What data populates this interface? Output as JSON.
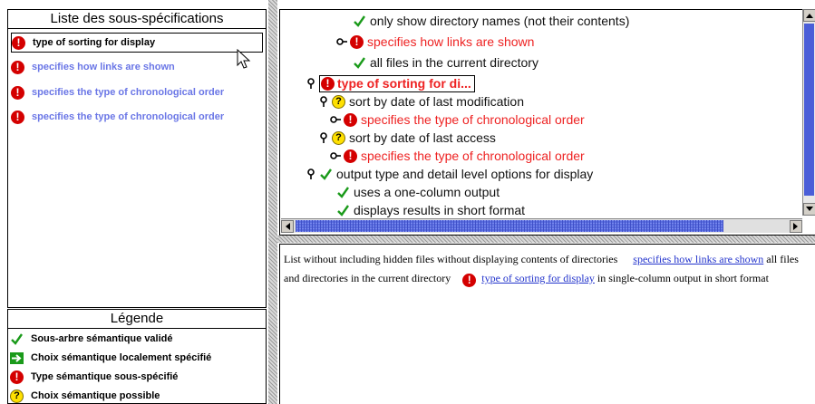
{
  "sublist": {
    "title": "Liste des sous-spécifications",
    "items": [
      {
        "label": "type of sorting for display",
        "selected": true
      },
      {
        "label": "specifies how links are shown",
        "selected": false
      },
      {
        "label": "specifies the type of chronological order",
        "selected": false
      },
      {
        "label": "specifies the type of chronological order",
        "selected": false
      }
    ]
  },
  "legend": {
    "title": "Légende",
    "items": [
      {
        "icon": "check-icon",
        "label": "Sous-arbre sémantique validé"
      },
      {
        "icon": "arrow-right-icon",
        "label": "Choix sémantique localement spécifié"
      },
      {
        "icon": "underspecified-icon",
        "label": "Type sémantique sous-spécifié"
      },
      {
        "icon": "possible-choice-icon",
        "label": "Choix sémantique possible"
      }
    ]
  },
  "tree": {
    "rows": [
      {
        "icon": "check-icon",
        "toggle": "none",
        "color": "black",
        "label": "only show directory names (not their contents)"
      },
      {
        "icon": "underspecified-icon",
        "toggle": "collapsed",
        "color": "red",
        "label": "specifies how links are shown"
      },
      {
        "icon": "check-icon",
        "toggle": "none",
        "color": "black",
        "label": "all files in the current directory"
      },
      {
        "icon": "underspecified-icon",
        "toggle": "expanded",
        "color": "red",
        "label": "type of sorting for di...",
        "focused": true
      },
      {
        "icon": "possible-choice-icon",
        "toggle": "expanded",
        "color": "black",
        "label": "sort by date of last modification"
      },
      {
        "icon": "underspecified-icon",
        "toggle": "collapsed",
        "color": "red",
        "label": "specifies the type of chronological order"
      },
      {
        "icon": "possible-choice-icon",
        "toggle": "expanded",
        "color": "black",
        "label": "sort by date of last access"
      },
      {
        "icon": "underspecified-icon",
        "toggle": "collapsed",
        "color": "red",
        "label": "specifies the type of chronological order"
      },
      {
        "icon": "check-icon",
        "toggle": "expanded",
        "color": "black",
        "label": "output type and detail level options for display"
      },
      {
        "icon": "check-icon",
        "toggle": "none",
        "color": "black",
        "label": "uses a one-column output"
      },
      {
        "icon": "check-icon",
        "toggle": "none",
        "color": "black",
        "label": "displays results in short format"
      }
    ]
  },
  "description": {
    "text1": "List without including hidden files without displaying contents of directories",
    "link1": "specifies how links are shown",
    "text2": "all files and directories in the current directory",
    "link2": "type of sorting for display",
    "text3": "in single-column output in short format"
  },
  "colors": {
    "underspecified": "#d40000",
    "possible": "#ffe000",
    "check": "#1a9a1a",
    "arrow": "#1a9a1a",
    "link_blue": "#6a76e6",
    "red_text": "#ee2222"
  }
}
